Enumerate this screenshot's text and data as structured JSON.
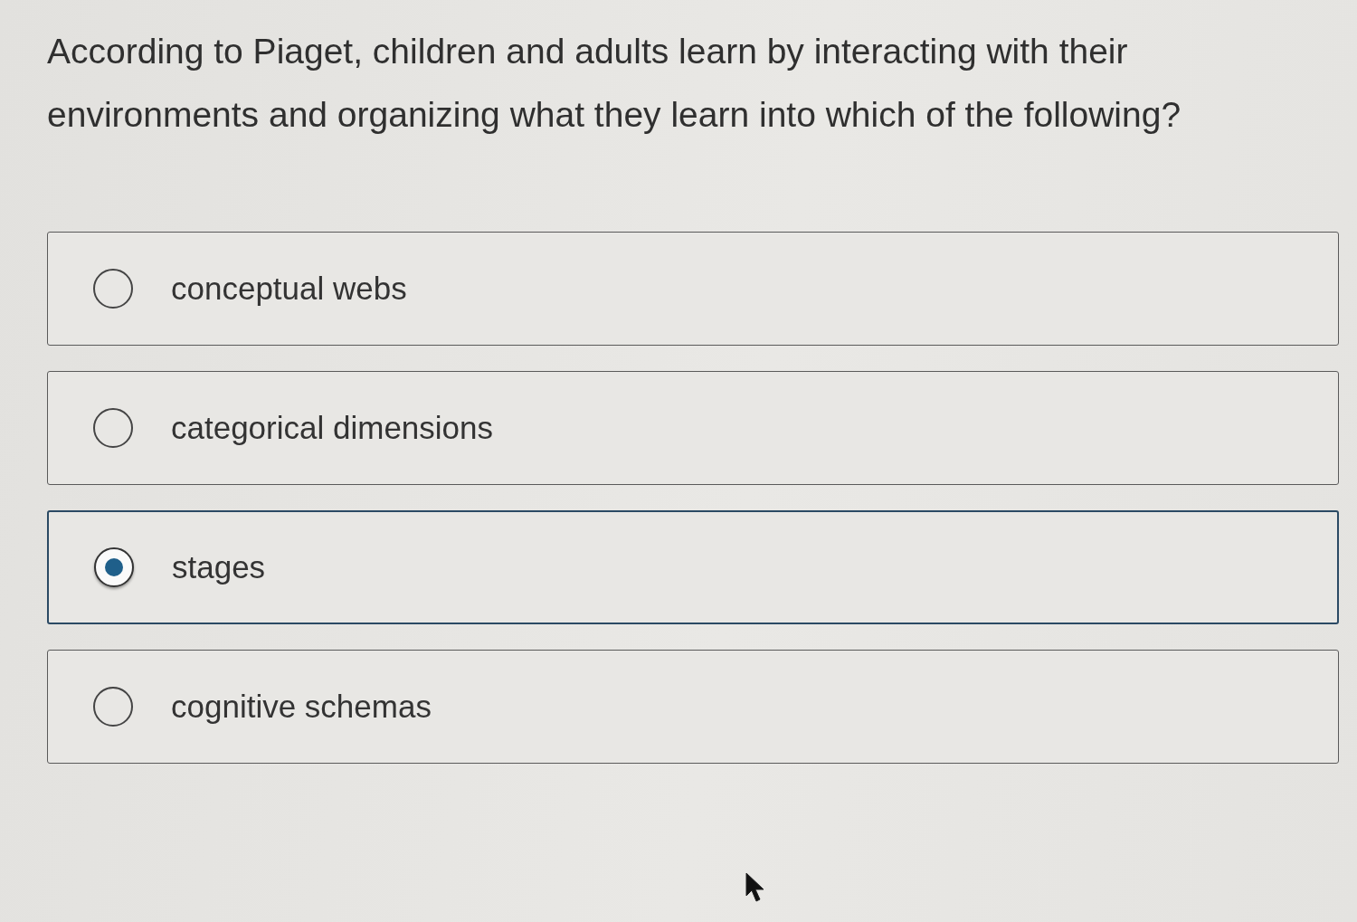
{
  "question": "According to Piaget, children and adults learn by interacting with their environments and organizing what they learn into which of the following?",
  "options": [
    {
      "label": "conceptual webs",
      "selected": false
    },
    {
      "label": "categorical dimensions",
      "selected": false
    },
    {
      "label": "stages",
      "selected": true
    },
    {
      "label": "cognitive schemas",
      "selected": false
    }
  ]
}
